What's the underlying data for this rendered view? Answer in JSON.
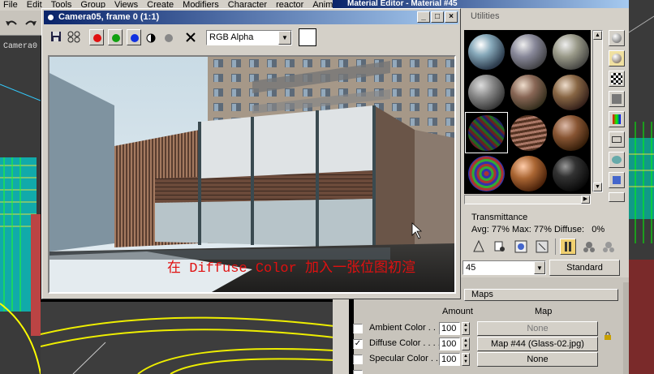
{
  "app": {
    "menu": [
      "File",
      "Edit",
      "Tools",
      "Group",
      "Views",
      "Create",
      "Modifiers",
      "Character",
      "reactor",
      "Anim"
    ],
    "viewport_label": "Camera0"
  },
  "render_window": {
    "title": "Camera05, frame 0 (1:1)",
    "channel": "RGB Alpha",
    "caption": "在 Diffuse Color 加入一张位图初渲",
    "colors": {
      "red": "#e01010",
      "green": "#10a010",
      "blue": "#1030e0"
    }
  },
  "material_editor": {
    "title": "Material Editor - Material #45",
    "utilities_tab": "Utilities",
    "transmittance_label": "Transmittance",
    "stats": {
      "avg_label": "Avg:",
      "avg": "77%",
      "max_label": "Max:",
      "max": "77%",
      "diffuse_label": "Diffuse:",
      "diffuse": "0%"
    },
    "material_name": "45",
    "type_button": "Standard",
    "maps_rollout": "Maps",
    "amount_header": "Amount",
    "map_header": "Map",
    "maps": [
      {
        "label": "Ambient Color . . . .",
        "amount": "100",
        "checked": false,
        "map": "None"
      },
      {
        "label": "Diffuse Color . . . .",
        "amount": "100",
        "checked": true,
        "map": "Map #44 (Glass-02.jpg)"
      },
      {
        "label": "Specular Color . . .",
        "amount": "100",
        "checked": false,
        "map": "None"
      }
    ]
  }
}
